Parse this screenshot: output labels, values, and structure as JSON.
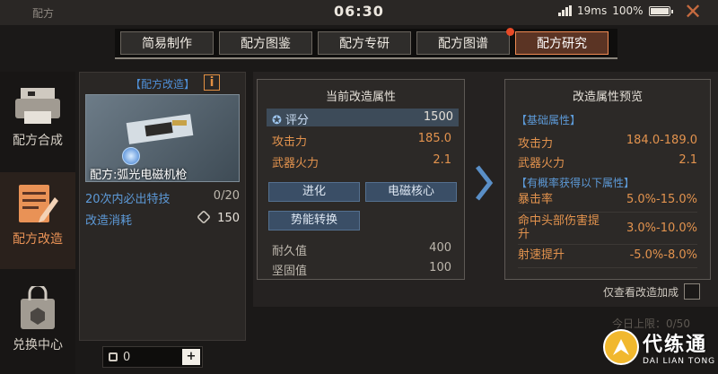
{
  "topbar": {
    "title": "配方",
    "clock": "06:30",
    "ping": "19ms",
    "battery": "100%"
  },
  "tabs": [
    {
      "label": "简易制作"
    },
    {
      "label": "配方图鉴"
    },
    {
      "label": "配方专研"
    },
    {
      "label": "配方图谱"
    },
    {
      "label": "配方研究"
    }
  ],
  "sidebar": {
    "items": [
      {
        "label": "配方合成"
      },
      {
        "label": "配方改造"
      },
      {
        "label": "兑换中心"
      }
    ]
  },
  "left_panel": {
    "header": "【配方改造】",
    "info_label": "i",
    "item_name": "配方:弧光电磁机枪",
    "guarantee_label": "20次内必出特技",
    "guarantee_progress": "0/20",
    "cost_label": "改造消耗",
    "cost_value": "150",
    "quantity": "0",
    "plus_label": "+"
  },
  "current": {
    "title": "当前改造属性",
    "score_label": "评分",
    "score_value": "1500",
    "attack_label": "攻击力",
    "attack_value": "185.0",
    "firepower_label": "武器火力",
    "firepower_value": "2.1",
    "btn_evolve": "进化",
    "btn_core": "电磁核心",
    "btn_convert": "势能转换",
    "durability_label": "耐久值",
    "durability_value": "400",
    "sturdy_label": "坚固值",
    "sturdy_value": "100"
  },
  "preview": {
    "title": "改造属性预览",
    "base_tag": "【基础属性】",
    "attack_label": "攻击力",
    "attack_value": "184.0-189.0",
    "firepower_label": "武器火力",
    "firepower_value": "2.1",
    "chance_tag": "【有概率获得以下属性】",
    "stats": [
      {
        "label": "暴击率",
        "value": "5.0%-15.0%"
      },
      {
        "label": "命中头部伤害提升",
        "value": "3.0%-10.0%"
      },
      {
        "label": "射速提升",
        "value": "-5.0%-8.0%"
      }
    ]
  },
  "footer": {
    "checkbox_label": "仅查看改造加成",
    "daily_limit": "今日上限：0/50"
  },
  "watermark": {
    "name": "代练通",
    "pinyin": "DAI LIAN TONG"
  }
}
